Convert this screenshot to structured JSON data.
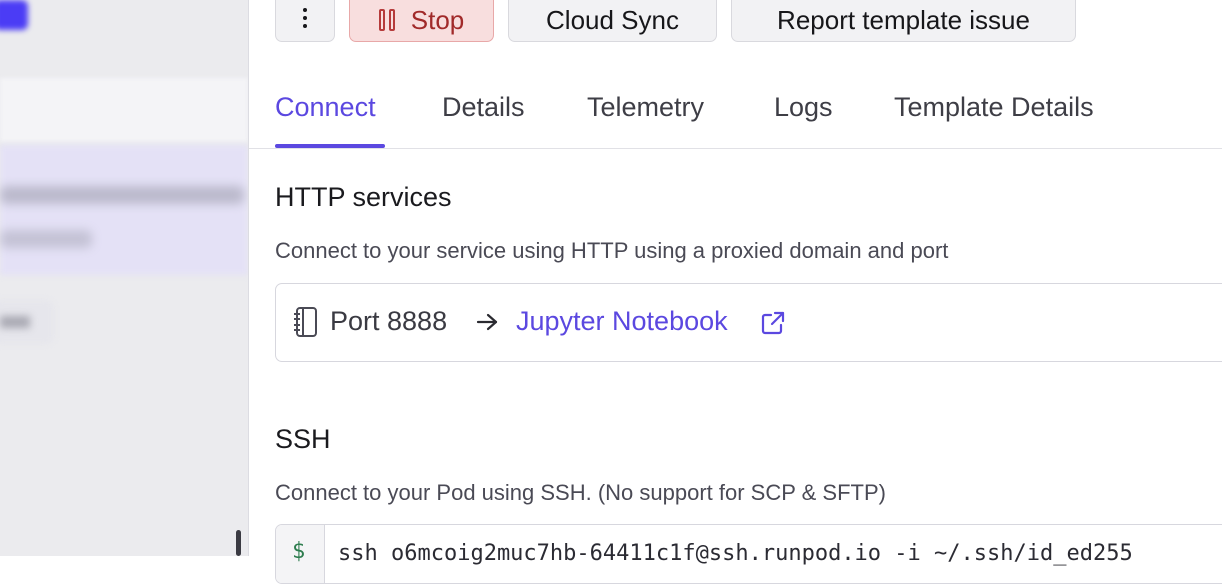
{
  "toolbar": {
    "stop_label": "Stop",
    "cloud_sync_label": "Cloud Sync",
    "report_label": "Report template issue"
  },
  "tabs": [
    {
      "label": "Connect",
      "active": true
    },
    {
      "label": "Details"
    },
    {
      "label": "Telemetry"
    },
    {
      "label": "Logs"
    },
    {
      "label": "Template Details"
    }
  ],
  "http": {
    "title": "HTTP services",
    "description": "Connect to your service using HTTP using a proxied domain and port",
    "port_label": "Port 8888",
    "link_label": "Jupyter Notebook"
  },
  "ssh": {
    "title": "SSH",
    "description": "Connect to your Pod using SSH. (No support for SCP & SFTP)",
    "prompt": "$",
    "command": "ssh o6mcoig2muc7hb-64411c1f@ssh.runpod.io -i ~/.ssh/id_ed255"
  },
  "colors": {
    "accent": "#5b48e0",
    "stop_bg": "#f8dede",
    "stop_text": "#a12a2a"
  },
  "icons": [
    "more-vertical-icon",
    "pause-icon",
    "notebook-icon",
    "arrow-right-icon",
    "external-link-icon"
  ]
}
